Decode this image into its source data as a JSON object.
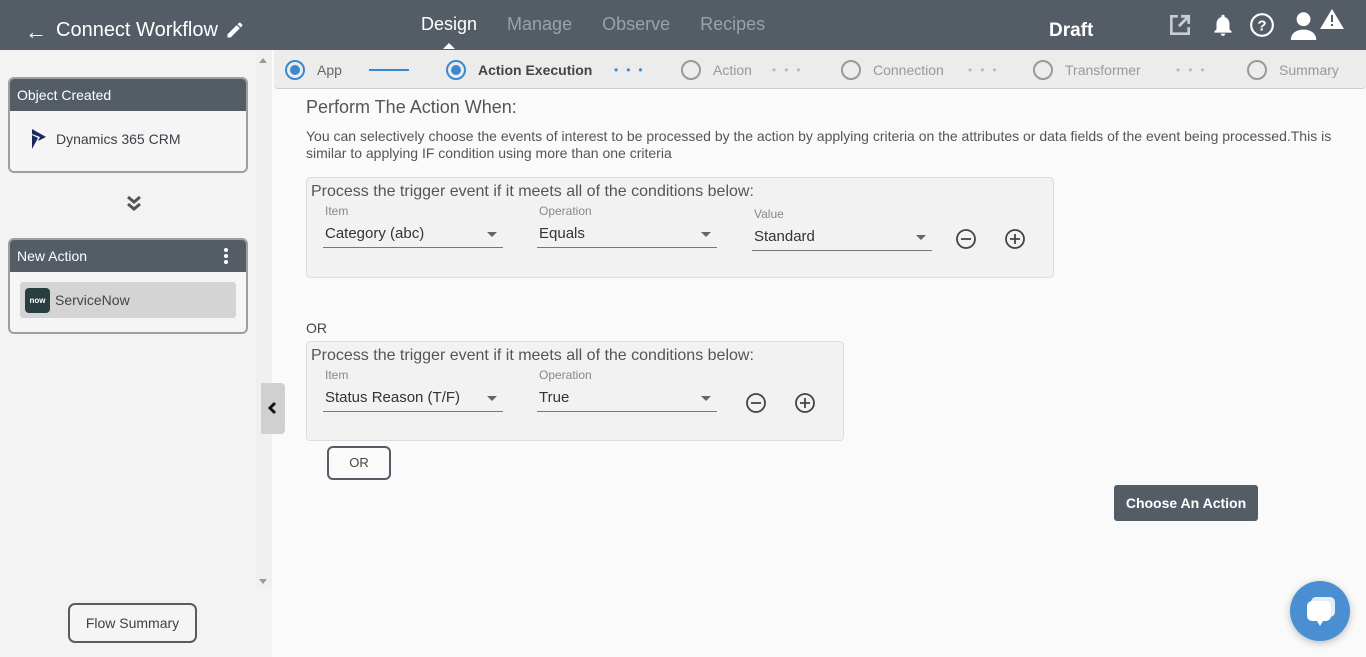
{
  "header": {
    "title": "Connect Workflow",
    "status": "Draft",
    "tabs": [
      {
        "label": "Design",
        "active": true
      },
      {
        "label": "Manage",
        "active": false
      },
      {
        "label": "Observe",
        "active": false
      },
      {
        "label": "Recipes",
        "active": false
      }
    ],
    "icons": [
      "back-arrow-icon",
      "pencil-icon",
      "external-link-icon",
      "bell-icon",
      "help-icon",
      "user-icon",
      "warning-icon"
    ]
  },
  "sidebar": {
    "trigger_card": {
      "title": "Object Created",
      "app": "Dynamics 365 CRM"
    },
    "action_card": {
      "title": "New Action",
      "app": "ServiceNow",
      "app_logo_text": "now"
    },
    "flow_summary_label": "Flow Summary"
  },
  "stepper": {
    "steps": [
      {
        "label": "App",
        "state": "done"
      },
      {
        "label": "Action Execution",
        "state": "active"
      },
      {
        "label": "Action",
        "state": "pending"
      },
      {
        "label": "Connection",
        "state": "pending"
      },
      {
        "label": "Transformer",
        "state": "pending"
      },
      {
        "label": "Summary",
        "state": "pending"
      }
    ]
  },
  "main": {
    "title": "Perform The Action When:",
    "description": "You can selectively choose the events of interest to be processed by the action by applying criteria on the attributes or data fields of the event being processed.This is similar to applying IF condition using more than one criteria",
    "groups": [
      {
        "title": "Process the trigger event if it meets all of the conditions below:",
        "item_label": "Item",
        "item_value": "Category (abc)",
        "operation_label": "Operation",
        "operation_value": "Equals",
        "value_label": "Value",
        "value_value": "Standard"
      },
      {
        "title": "Process the trigger event if it meets all of the conditions below:",
        "item_label": "Item",
        "item_value": "Status Reason (T/F)",
        "operation_label": "Operation",
        "operation_value": "True"
      }
    ],
    "or_separator": "OR",
    "or_button": "OR",
    "choose_button": "Choose An Action"
  },
  "colors": {
    "header_bg": "#545d66",
    "accent": "#3d87cc",
    "chat_fab": "#4a8fd1"
  }
}
